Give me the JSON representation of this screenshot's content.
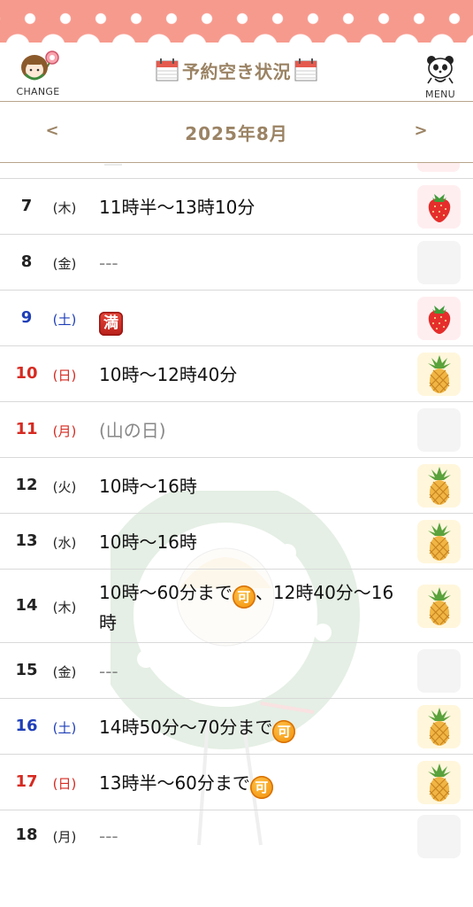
{
  "header": {
    "title": "予約空き状況",
    "change_label": "CHANGE",
    "menu_label": "MENU"
  },
  "month_nav": {
    "prev": "<",
    "month": "2025年8月",
    "next": ">"
  },
  "days": [
    {
      "day": "7",
      "weekday": "(木)",
      "text": "11時半〜13時10分",
      "badge": null,
      "text_gray": false,
      "icon": "strawberry-icon",
      "day_color": "black"
    },
    {
      "day": "8",
      "weekday": "(金)",
      "text": "---",
      "badge": null,
      "text_gray": true,
      "icon": null,
      "day_color": "black"
    },
    {
      "day": "9",
      "weekday": "(土)",
      "text": "",
      "badge": "満",
      "text_gray": false,
      "icon": "strawberry-icon",
      "day_color": "blue"
    },
    {
      "day": "10",
      "weekday": "(日)",
      "text": "10時〜12時40分",
      "badge": null,
      "text_gray": false,
      "icon": "pineapple-icon",
      "day_color": "red"
    },
    {
      "day": "11",
      "weekday": "(月)",
      "text": "(山の日)",
      "badge": null,
      "text_gray": true,
      "icon": null,
      "day_color": "red"
    },
    {
      "day": "12",
      "weekday": "(火)",
      "text": "10時〜16時",
      "badge": null,
      "text_gray": false,
      "icon": "pineapple-icon",
      "day_color": "black"
    },
    {
      "day": "13",
      "weekday": "(水)",
      "text": "10時〜16時",
      "badge": null,
      "text_gray": false,
      "icon": "pineapple-icon",
      "day_color": "black"
    },
    {
      "day": "14",
      "weekday": "(木)",
      "text_before": "10時〜60分まで",
      "badge": "可",
      "text_after": "、12時40分〜16時",
      "text_gray": false,
      "icon": "pineapple-icon",
      "day_color": "black"
    },
    {
      "day": "15",
      "weekday": "(金)",
      "text": "---",
      "badge": null,
      "text_gray": true,
      "icon": null,
      "day_color": "black"
    },
    {
      "day": "16",
      "weekday": "(土)",
      "text_before": "14時50分〜70分まで",
      "badge": "可",
      "text_after": "",
      "text_gray": false,
      "icon": "pineapple-icon",
      "day_color": "blue"
    },
    {
      "day": "17",
      "weekday": "(日)",
      "text_before": "13時半〜60分まで",
      "badge": "可",
      "text_after": "",
      "text_gray": false,
      "icon": "pineapple-icon",
      "day_color": "red"
    },
    {
      "day": "18",
      "weekday": "(月)",
      "text": "---",
      "badge": null,
      "text_gray": true,
      "icon": null,
      "day_color": "black"
    }
  ],
  "colors": {
    "banner": "#f79a8e",
    "accent_brown": "#9b8364",
    "saturday_blue": "#1f3fb8",
    "sunday_red": "#d62a21",
    "available_badge": "#f39a10",
    "full_badge": "#d8342a"
  }
}
